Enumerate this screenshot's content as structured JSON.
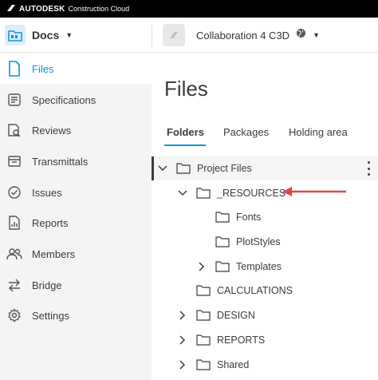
{
  "topbar": {
    "brand": "AUTODESK",
    "brand_sub": "Construction Cloud"
  },
  "header": {
    "app_selector": {
      "label": "Docs",
      "icon": "docs-folder-icon"
    },
    "project_selector": {
      "label": "Collaboration 4 C3D",
      "icon": "globe-icon"
    }
  },
  "sidebar": {
    "items": [
      {
        "label": "Files",
        "icon": "file-icon",
        "active": true
      },
      {
        "label": "Specifications",
        "icon": "specifications-icon"
      },
      {
        "label": "Reviews",
        "icon": "reviews-icon"
      },
      {
        "label": "Transmittals",
        "icon": "transmittals-icon"
      },
      {
        "label": "Issues",
        "icon": "issues-check-icon"
      },
      {
        "label": "Reports",
        "icon": "reports-icon"
      },
      {
        "label": "Members",
        "icon": "members-icon"
      },
      {
        "label": "Bridge",
        "icon": "bridge-arrows-icon"
      },
      {
        "label": "Settings",
        "icon": "gear-icon"
      }
    ]
  },
  "main": {
    "title": "Files",
    "tabs": [
      {
        "label": "Folders",
        "active": true
      },
      {
        "label": "Packages"
      },
      {
        "label": "Holding area"
      }
    ],
    "tree": [
      {
        "label": "Project Files",
        "level": 0,
        "chevron": "down",
        "selected": true
      },
      {
        "label": "_RESOURCES",
        "level": 1,
        "chevron": "down",
        "highlighted_by_arrow": true
      },
      {
        "label": "Fonts",
        "level": 2,
        "chevron": "none"
      },
      {
        "label": "PlotStyles",
        "level": 2,
        "chevron": "none"
      },
      {
        "label": "Templates",
        "level": 2,
        "chevron": "right"
      },
      {
        "label": "CALCULATIONS",
        "level": 1,
        "chevron": "none"
      },
      {
        "label": "DESIGN",
        "level": 1,
        "chevron": "right"
      },
      {
        "label": "REPORTS",
        "level": 1,
        "chevron": "right"
      },
      {
        "label": "Shared",
        "level": 1,
        "chevron": "right"
      }
    ],
    "annotation_arrow_color": "#e04545"
  },
  "colors": {
    "accent": "#0696d7",
    "sidebar_bg": "#f4f4f4",
    "text": "#3c3c3c"
  }
}
